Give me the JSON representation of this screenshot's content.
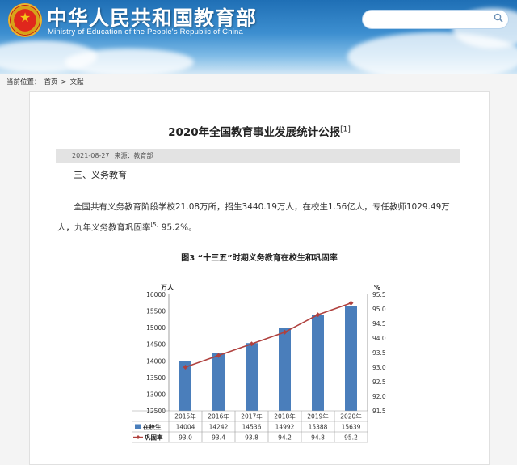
{
  "header": {
    "site_title": "中华人民共和国教育部",
    "site_subtitle": "Ministry of Education of the People's Republic of China"
  },
  "breadcrumb": {
    "prefix": "当前位置：",
    "home": "首页",
    "sep": ">",
    "section": "文献"
  },
  "article": {
    "title": "2020年全国教育事业发展统计公报",
    "title_ref": "[1]",
    "date": "2021-08-27",
    "source": "来源：教育部",
    "section_heading": "三、义务教育",
    "paragraph_main": "全国共有义务教育阶段学校21.08万所，招生3440.19万人，在校生1.56亿人，专任教师1029.49万人，九年义务教育巩固率",
    "paragraph_ref": "[5]",
    "paragraph_tail": " 95.2%。",
    "figure_title": "图3  “十三五”时期义务教育在校生和巩固率"
  },
  "colors": {
    "bar": "#4a7ebb",
    "line": "#b0413e",
    "accent": "#1f6fb5"
  },
  "chart_data": {
    "type": "bar",
    "categories": [
      "2015年",
      "2016年",
      "2017年",
      "2018年",
      "2019年",
      "2020年"
    ],
    "series": [
      {
        "name": "在校生",
        "type": "bar",
        "axis": "left",
        "values": [
          14004,
          14242,
          14536,
          14992,
          15388,
          15639
        ]
      },
      {
        "name": "巩固率",
        "type": "line",
        "axis": "right",
        "values": [
          93.0,
          93.4,
          93.8,
          94.2,
          94.8,
          95.2
        ]
      }
    ],
    "ylabel_left": "万人",
    "ylabel_right": "%",
    "ylim_left": [
      12500,
      16000
    ],
    "yticks_left": [
      12500,
      13000,
      13500,
      14000,
      14500,
      15000,
      15500,
      16000
    ],
    "ylim_right": [
      91.5,
      95.5
    ],
    "yticks_right": [
      91.5,
      92.0,
      92.5,
      93.0,
      93.5,
      94.0,
      94.5,
      95.0,
      95.5
    ],
    "data_table": true,
    "legend": "table-left"
  }
}
